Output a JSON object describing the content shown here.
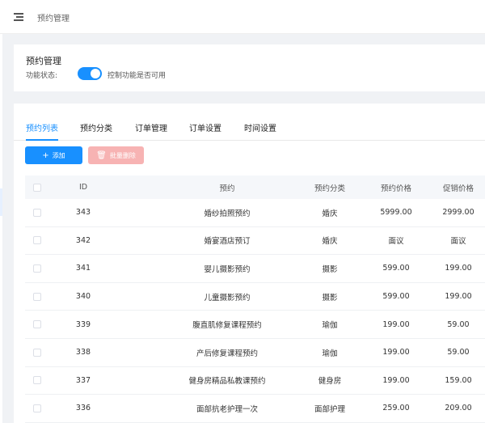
{
  "header": {
    "breadcrumb": "预约管理",
    "menu_icon": "hamburger-icon"
  },
  "settings": {
    "title": "预约管理",
    "status_label": "功能状态:",
    "toggle_on": true,
    "hint": "控制功能是否可用",
    "accent": "#1890ff"
  },
  "tabs": [
    {
      "label": "预约列表",
      "active": true
    },
    {
      "label": "预约分类",
      "active": false
    },
    {
      "label": "订单管理",
      "active": false
    },
    {
      "label": "订单设置",
      "active": false
    },
    {
      "label": "时间设置",
      "active": false
    }
  ],
  "toolbar": {
    "add_label": "添加",
    "add_icon": "plus-icon",
    "delete_label": "批量删除",
    "delete_icon": "trash-icon"
  },
  "table": {
    "columns": [
      "ID",
      "预约",
      "预约分类",
      "预约价格",
      "促销价格"
    ],
    "rows": [
      {
        "id": "343",
        "name": "婚纱拍照预约",
        "category": "婚庆",
        "price": "5999.00",
        "promo": "2999.00"
      },
      {
        "id": "342",
        "name": "婚宴酒店预订",
        "category": "婚庆",
        "price": "面议",
        "promo": "面议"
      },
      {
        "id": "341",
        "name": "婴儿摄影预约",
        "category": "摄影",
        "price": "599.00",
        "promo": "199.00"
      },
      {
        "id": "340",
        "name": "儿童摄影预约",
        "category": "摄影",
        "price": "599.00",
        "promo": "199.00"
      },
      {
        "id": "339",
        "name": "腹直肌修复课程预约",
        "category": "瑜伽",
        "price": "199.00",
        "promo": "59.00"
      },
      {
        "id": "338",
        "name": "产后修复课程预约",
        "category": "瑜伽",
        "price": "199.00",
        "promo": "59.00"
      },
      {
        "id": "337",
        "name": "健身房精品私教课预约",
        "category": "健身房",
        "price": "199.00",
        "promo": "159.00"
      },
      {
        "id": "336",
        "name": "面部抗老护理一次",
        "category": "面部护理",
        "price": "259.00",
        "promo": "209.00"
      }
    ]
  }
}
